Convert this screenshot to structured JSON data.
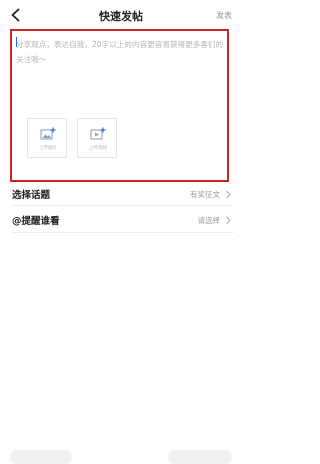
{
  "header": {
    "title": "快速发帖",
    "publish_label": "发表"
  },
  "editor": {
    "placeholder": "分享观点，表达自我，20字以上的内容更容易获得更多客们的关注哦～",
    "media_buttons": [
      {
        "label": "上传图片",
        "icon": "image-plus-icon"
      },
      {
        "label": "上传视频",
        "icon": "video-plus-icon"
      }
    ]
  },
  "rows": [
    {
      "label": "选择话题",
      "value": "有奖征文"
    },
    {
      "label": "@提醒谁看",
      "value": "请选择"
    }
  ],
  "colors": {
    "highlight_border": "#c8262b",
    "caret": "#2b6cdf",
    "muted_text": "#9a9a9a"
  }
}
